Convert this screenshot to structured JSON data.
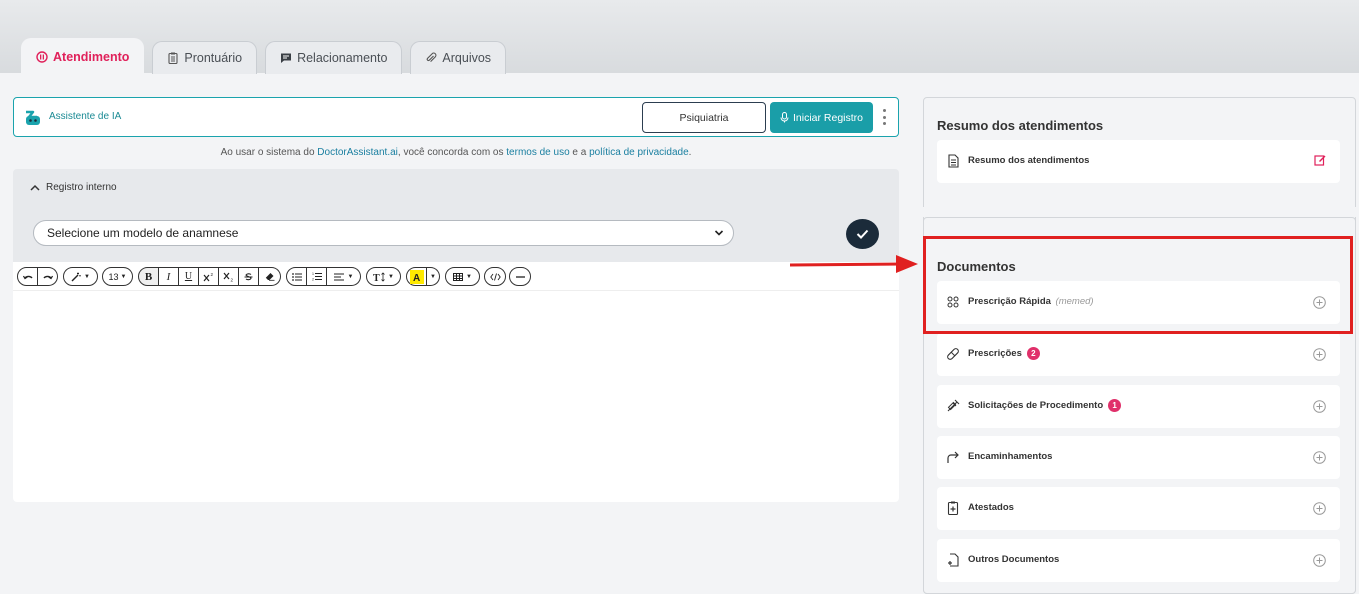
{
  "tabs": [
    {
      "label": "Atendimento",
      "icon": "attendance-icon",
      "active": true
    },
    {
      "label": "Prontuário",
      "icon": "clipboard-icon",
      "active": false
    },
    {
      "label": "Relacionamento",
      "icon": "chat-icon",
      "active": false
    },
    {
      "label": "Arquivos",
      "icon": "paperclip-icon",
      "active": false
    }
  ],
  "ai": {
    "label": "Assistente de IA",
    "specialty_button": "Psiquiatria",
    "start_button": "Iniciar Registro"
  },
  "consent": {
    "prefix": "Ao usar o sistema do ",
    "site": "DoctorAssistant.ai",
    "middle": ", você concorda com os ",
    "terms": "termos de uso",
    "and": " e a ",
    "privacy": "política de privacidade",
    "suffix": "."
  },
  "registro": {
    "title": "Registro interno",
    "select_value": "Selecione um modelo de anamnese"
  },
  "toolbar": {
    "font_size": "13",
    "bold": "B",
    "italic": "I",
    "underline": "U"
  },
  "resumo": {
    "title": "Resumo dos atendimentos",
    "item": "Resumo dos atendimentos"
  },
  "documentos": {
    "title": "Documentos",
    "items": [
      {
        "label": "Prescrição Rápida",
        "suffix": "(memed)",
        "icon": "quick-prescription-icon"
      },
      {
        "label": "Prescrições",
        "badge": "2",
        "icon": "pill-icon"
      },
      {
        "label": "Solicitações de Procedimento",
        "badge": "1",
        "icon": "syringe-icon"
      },
      {
        "label": "Encaminhamentos",
        "icon": "forward-arrow-icon"
      },
      {
        "label": "Atestados",
        "icon": "medical-certificate-icon"
      },
      {
        "label": "Outros Documentos",
        "icon": "document-add-icon"
      }
    ]
  },
  "colors": {
    "accent_pink": "#e0205a",
    "teal": "#1a9ea8",
    "highlight_red": "#e02020",
    "navy": "#1b2b3a"
  }
}
